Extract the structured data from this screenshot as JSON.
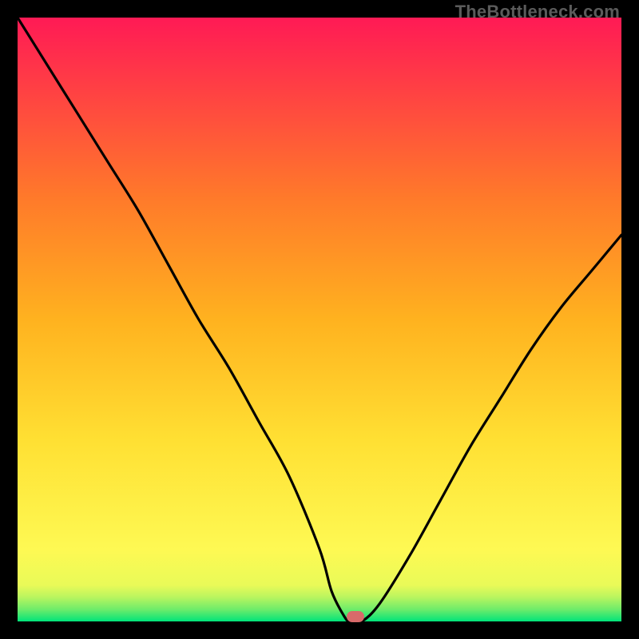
{
  "watermark": "TheBottleneck.com",
  "colors": {
    "curve": "#000000",
    "marker": "#d86a6a",
    "frame": "#000000"
  },
  "chart_data": {
    "type": "line",
    "title": "",
    "xlabel": "",
    "ylabel": "",
    "xlim": [
      0,
      100
    ],
    "ylim": [
      0,
      100
    ],
    "gradient": [
      {
        "stop": 0.0,
        "color": "#00e47a"
      },
      {
        "stop": 0.02,
        "color": "#6eec6a"
      },
      {
        "stop": 0.04,
        "color": "#b9f55f"
      },
      {
        "stop": 0.06,
        "color": "#e9fa58"
      },
      {
        "stop": 0.12,
        "color": "#fef953"
      },
      {
        "stop": 0.3,
        "color": "#ffe033"
      },
      {
        "stop": 0.5,
        "color": "#ffb21f"
      },
      {
        "stop": 0.7,
        "color": "#ff7a2a"
      },
      {
        "stop": 0.85,
        "color": "#ff4a3f"
      },
      {
        "stop": 1.0,
        "color": "#ff1a55"
      }
    ],
    "series": [
      {
        "name": "bottleneck-curve",
        "x": [
          0,
          5,
          10,
          15,
          20,
          25,
          30,
          35,
          40,
          45,
          50,
          52,
          54,
          55,
          57,
          60,
          65,
          70,
          75,
          80,
          85,
          90,
          95,
          100
        ],
        "y": [
          100,
          92,
          84,
          76,
          68,
          59,
          50,
          42,
          33,
          24,
          12,
          5,
          1,
          0,
          0,
          3,
          11,
          20,
          29,
          37,
          45,
          52,
          58,
          64
        ]
      }
    ],
    "marker": {
      "x": 56,
      "y": 0.8
    },
    "annotations": []
  }
}
